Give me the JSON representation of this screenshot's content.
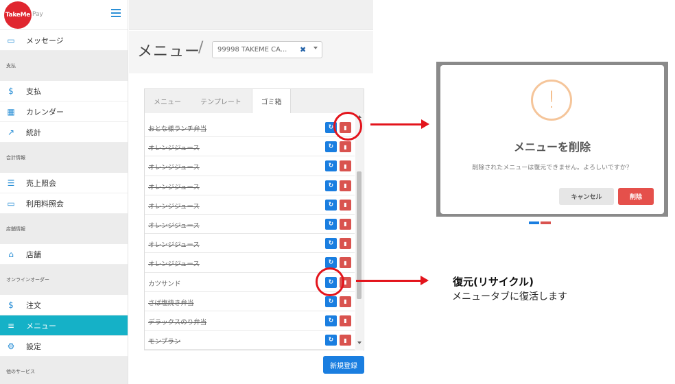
{
  "brand": {
    "logo_text": "TakeMe",
    "logo_suffix": "Pay"
  },
  "sidebar": {
    "items": [
      {
        "type": "item",
        "label": "メッセージ",
        "icon": "message-icon"
      },
      {
        "type": "section",
        "label": "支払"
      },
      {
        "type": "item",
        "label": "支払",
        "icon": "dollar-icon"
      },
      {
        "type": "item",
        "label": "カレンダー",
        "icon": "calendar-icon"
      },
      {
        "type": "item",
        "label": "統計",
        "icon": "chart-icon"
      },
      {
        "type": "section",
        "label": "会計情報"
      },
      {
        "type": "item",
        "label": "売上照会",
        "icon": "list-icon"
      },
      {
        "type": "item",
        "label": "利用料照会",
        "icon": "card-icon"
      },
      {
        "type": "section",
        "label": "店舗情報"
      },
      {
        "type": "item",
        "label": "店舗",
        "icon": "home-icon"
      },
      {
        "type": "section",
        "label": "オンラインオーダー"
      },
      {
        "type": "item",
        "label": "注文",
        "icon": "dollar-icon"
      },
      {
        "type": "item",
        "label": "メニュー",
        "icon": "menu-icon",
        "active": true
      },
      {
        "type": "item",
        "label": "設定",
        "icon": "gear-icon"
      },
      {
        "type": "section",
        "label": "他のサービス"
      }
    ]
  },
  "header": {
    "title": "メニュー",
    "separator": "/",
    "store_select_value": "99998 TAKEME CA..."
  },
  "tabs": [
    {
      "label": "メニュー",
      "active": false
    },
    {
      "label": "テンプレート",
      "active": false
    },
    {
      "label": "ゴミ箱",
      "active": true
    }
  ],
  "trash_items": [
    {
      "label": "おとな様ランチ弁当",
      "strike": true
    },
    {
      "label": "オレンジジュース",
      "strike": true
    },
    {
      "label": "オレンジジュース",
      "strike": true
    },
    {
      "label": "オレンジジュース",
      "strike": true
    },
    {
      "label": "オレンジジュース",
      "strike": true
    },
    {
      "label": "オレンジジュース",
      "strike": true
    },
    {
      "label": "オレンジジュース",
      "strike": true
    },
    {
      "label": "オレンジジュース",
      "strike": true
    },
    {
      "label": "カツサンド",
      "strike": false
    },
    {
      "label": "さば塩焼き弁当",
      "strike": true
    },
    {
      "label": "デラックスのり弁当",
      "strike": true
    },
    {
      "label": "モンブラン",
      "strike": true
    }
  ],
  "icons": {
    "restore": "recycle-icon",
    "delete": "trash-icon"
  },
  "new_button_label": "新規登録",
  "modal": {
    "icon_text": "!",
    "title": "メニューを削除",
    "message": "削除されたメニューは復元できません。よろしいですか？",
    "cancel_label": "キャンセル",
    "delete_label": "削除"
  },
  "annotation": {
    "title": "復元(リサイクル)",
    "subtitle": "メニュータブに復活します"
  },
  "colors": {
    "brand_red": "#e0262f",
    "active_nav": "#15b1c7",
    "primary_blue": "#1a7ee0",
    "danger_red": "#d9534f",
    "annotation_red": "#e3141c"
  }
}
